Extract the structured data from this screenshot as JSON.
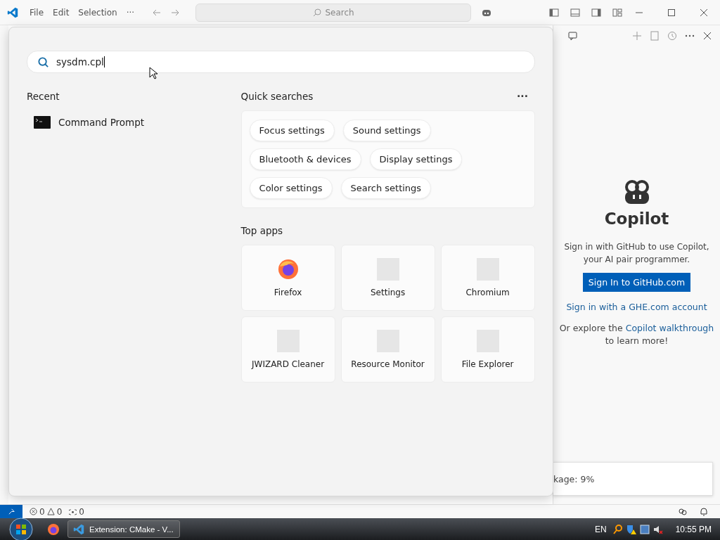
{
  "titlebar": {
    "menus": [
      "File",
      "Edit",
      "Selection",
      "···"
    ],
    "search_placeholder": "Search"
  },
  "start_search": {
    "query": "sysdm.cpl",
    "recent_heading": "Recent",
    "recent": [
      {
        "label": "Command Prompt"
      }
    ],
    "quick_heading": "Quick searches",
    "more": "···",
    "quick_searches": [
      [
        "Focus settings",
        "Sound settings"
      ],
      [
        "Bluetooth & devices",
        "Display settings"
      ],
      [
        "Color settings",
        "Search settings"
      ]
    ],
    "top_apps_heading": "Top apps",
    "top_apps": [
      {
        "label": "Firefox",
        "kind": "firefox"
      },
      {
        "label": "Settings",
        "kind": "blank"
      },
      {
        "label": "Chromium",
        "kind": "blank"
      },
      {
        "label": "JWIZARD Cleaner",
        "kind": "blank"
      },
      {
        "label": "Resource Monitor",
        "kind": "blank"
      },
      {
        "label": "File Explorer",
        "kind": "blank"
      }
    ]
  },
  "copilot_pane": {
    "title": "Copilot",
    "description": "Sign in with GitHub to use Copilot, your AI pair programmer.",
    "sign_in_button": "Sign In to GitHub.com",
    "ghe_link": "Sign in with a GHE.com account",
    "explore_prefix": "Or explore the",
    "walkthrough_link": "Copilot walkthrough",
    "explore_suffix": "to learn more!",
    "notification": "kage: 9%"
  },
  "status_bar": {
    "errors": "0",
    "warnings": "0",
    "ports": "0"
  },
  "taskbar": {
    "window": "Extension: CMake - V...",
    "language": "EN",
    "clock": "10:55 PM"
  }
}
